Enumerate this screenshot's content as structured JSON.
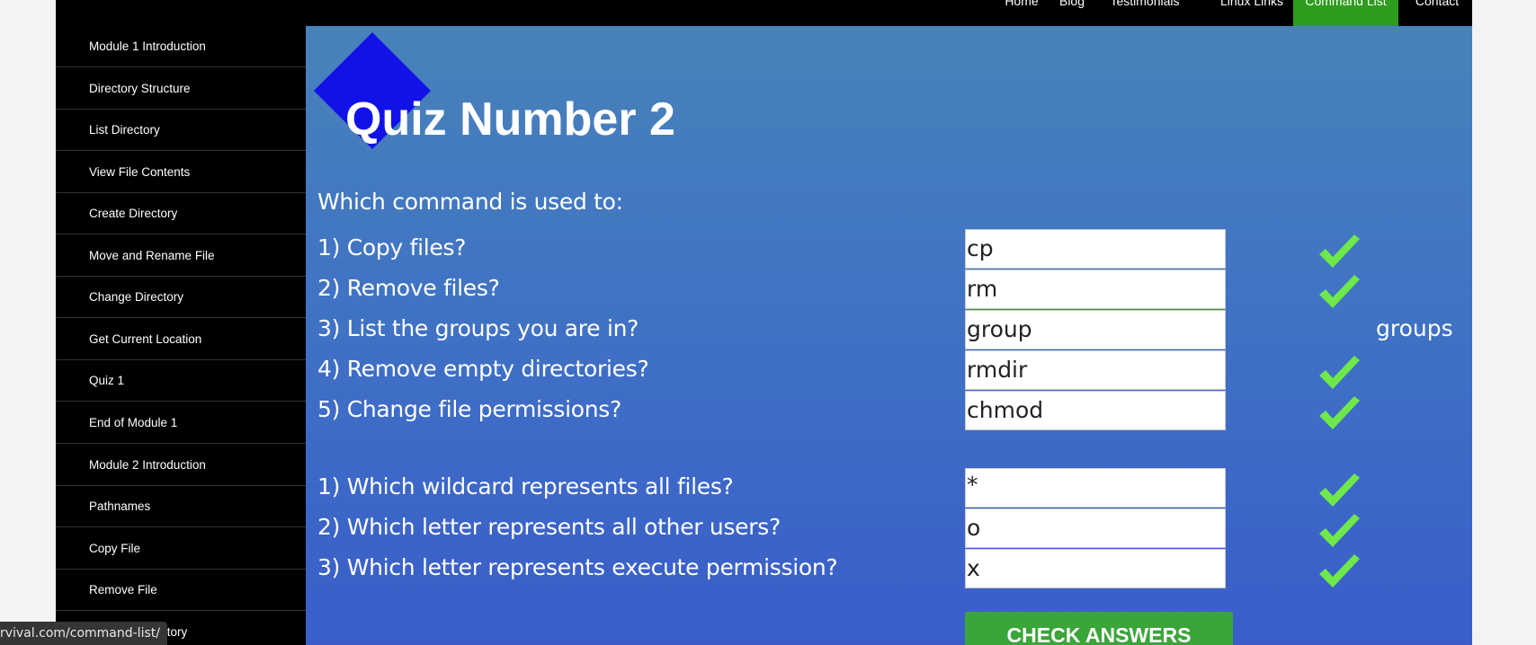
{
  "nav": {
    "items": [
      "Home",
      "Blog",
      "Testimonials",
      "Linux Links",
      "Command List",
      "Contact"
    ],
    "active": "Command List"
  },
  "sidebar": {
    "items": [
      "Module 1 Introduction",
      "Directory Structure",
      "List Directory",
      "View File Contents",
      "Create Directory",
      "Move and Rename File",
      "Change Directory",
      "Get Current Location",
      "Quiz 1",
      "End of Module 1",
      "Module 2 Introduction",
      "Pathnames",
      "Copy File",
      "Remove File",
      "ctory"
    ]
  },
  "quiz": {
    "title": "Quiz Number 2",
    "intro": "Which command is used to:",
    "section1": [
      {
        "question": "1) Copy files?",
        "answer": "cp",
        "correct": true,
        "correction": ""
      },
      {
        "question": "2) Remove files?",
        "answer": "rm",
        "correct": true,
        "correction": ""
      },
      {
        "question": "3) List the groups you are in?",
        "answer": "group",
        "correct": false,
        "correction": "groups"
      },
      {
        "question": "4) Remove empty directories?",
        "answer": "rmdir",
        "correct": true,
        "correction": ""
      },
      {
        "question": "5) Change file permissions?",
        "answer": "chmod",
        "correct": true,
        "correction": ""
      }
    ],
    "section2": [
      {
        "question": "1) Which wildcard represents all files?",
        "answer": "*",
        "correct": true,
        "correction": ""
      },
      {
        "question": "2) Which letter represents all other users?",
        "answer": "o",
        "correct": true,
        "correction": ""
      },
      {
        "question": "3) Which letter represents execute permission?",
        "answer": "x",
        "correct": true,
        "correction": ""
      }
    ],
    "check_button": "CHECK ANSWERS"
  },
  "status_bar": {
    "url": "rvival.com/command-list/"
  },
  "colors": {
    "nav_active": "#2e9c1c",
    "logo_diamond": "#1212e8",
    "check_mark": "#6ee84a",
    "button": "#3aa539"
  },
  "icons": {
    "correct": "check-mark-icon"
  }
}
